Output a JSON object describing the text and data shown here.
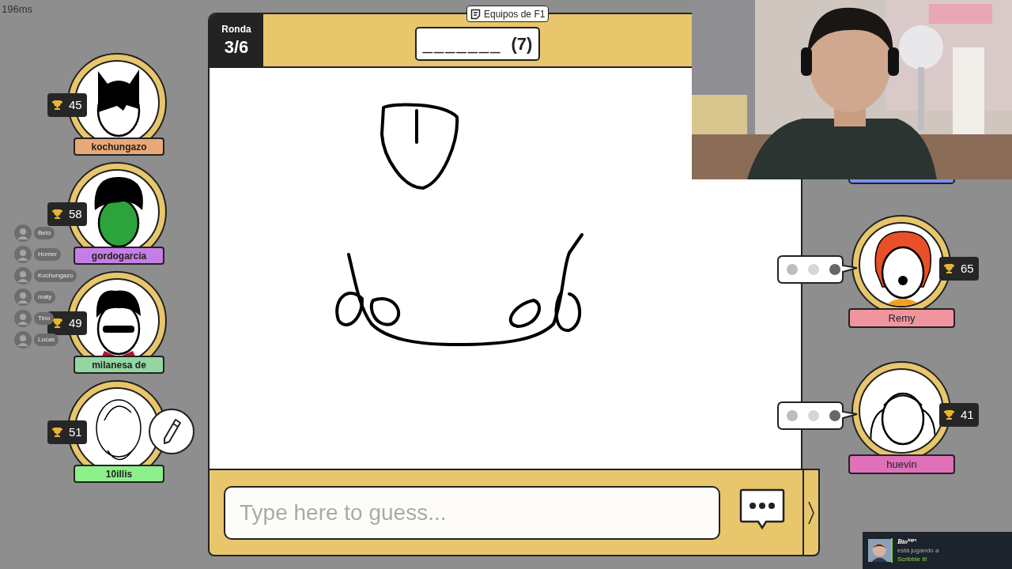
{
  "ping": "196ms",
  "round": {
    "label": "Ronda",
    "value": "3/6"
  },
  "team_tag": "Equipos de F1",
  "word_hint": {
    "blanks": "_______",
    "length": "(7)"
  },
  "players_left": [
    {
      "name": "kochungazo",
      "score": "45",
      "color": "#e9a877",
      "kind": "mask",
      "drawing": false
    },
    {
      "name": "gordogarcia",
      "score": "58",
      "color": "#c57ee6",
      "kind": "monster",
      "drawing": false
    },
    {
      "name": "milanesa de",
      "score": "49",
      "color": "#93d6a2",
      "kind": "vampire",
      "drawing": false
    },
    {
      "name": "10illis",
      "score": "51",
      "color": "#8ef08a",
      "kind": "sketch",
      "drawing": true
    }
  ],
  "players_right": [
    {
      "name": "Remy",
      "score": "65",
      "color": "#f0959e",
      "kind": "clown",
      "typing": true
    },
    {
      "name": "huevin",
      "score": "41",
      "color": "#e070b9",
      "kind": "pigtails",
      "typing": true
    }
  ],
  "voice_chat": [
    {
      "name": "Beto"
    },
    {
      "name": "Homer"
    },
    {
      "name": "Kochungazo"
    },
    {
      "name": "maty"
    },
    {
      "name": "Tino"
    },
    {
      "name": "Lucas"
    }
  ],
  "guess_field": {
    "placeholder": "Type here to guess..."
  },
  "notification": {
    "user": "Bto$^{taps}$",
    "line": "está jugando a",
    "game": "Scribble It!"
  }
}
